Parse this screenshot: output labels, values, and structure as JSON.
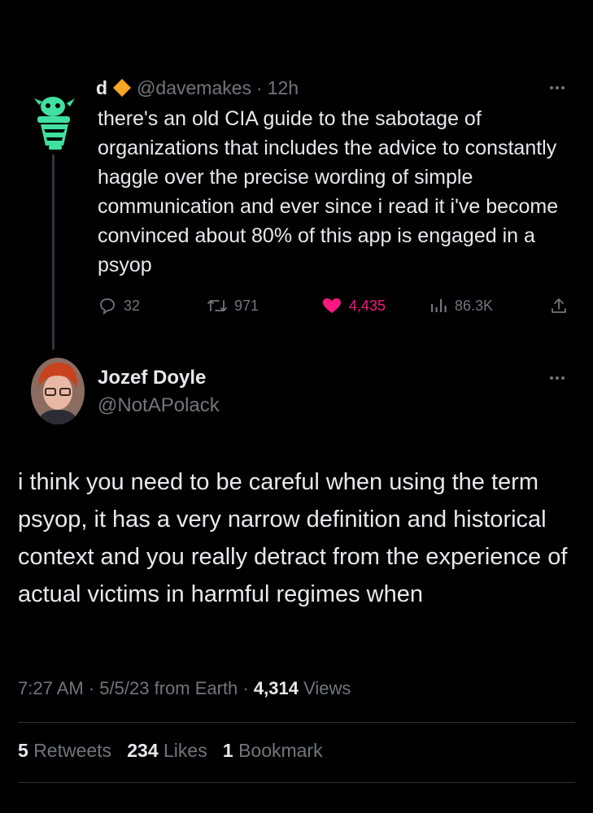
{
  "parent_tweet": {
    "display_name": "d",
    "handle": "@davemakes",
    "separator": "·",
    "time": "12h",
    "text": "there's an old CIA guide to the sabotage of organizations that includes the advice to constantly haggle over the precise wording of simple communication and ever since i read it i've become convinced about 80% of this app is engaged in a psyop",
    "actions": {
      "replies": "32",
      "retweets": "971",
      "likes": "4,435",
      "views": "86.3K"
    },
    "icons": {
      "badge": "orange-diamond-icon",
      "avatar": "green-illustration-avatar"
    }
  },
  "reply_tweet": {
    "display_name": "Jozef Doyle",
    "handle": "@NotAPolack",
    "text": "i think you need to be careful when using the term psyop, it has a very narrow definition and historical context and you really detract from the experience of actual victims in harmful regimes when",
    "meta": {
      "time": "7:27 AM",
      "separator": "·",
      "date": "5/5/23",
      "source": "from Earth",
      "views_count": "4,314",
      "views_label": "Views"
    },
    "stats": {
      "retweets_count": "5",
      "retweets_label": "Retweets",
      "likes_count": "234",
      "likes_label": "Likes",
      "bookmarks_count": "1",
      "bookmarks_label": "Bookmark"
    }
  },
  "colors": {
    "background": "#000000",
    "text_primary": "#e7e9ea",
    "text_secondary": "#71767b",
    "like_pink": "#f91880",
    "badge_orange": "#f5a623",
    "avatar_green": "#3fe0a0"
  }
}
